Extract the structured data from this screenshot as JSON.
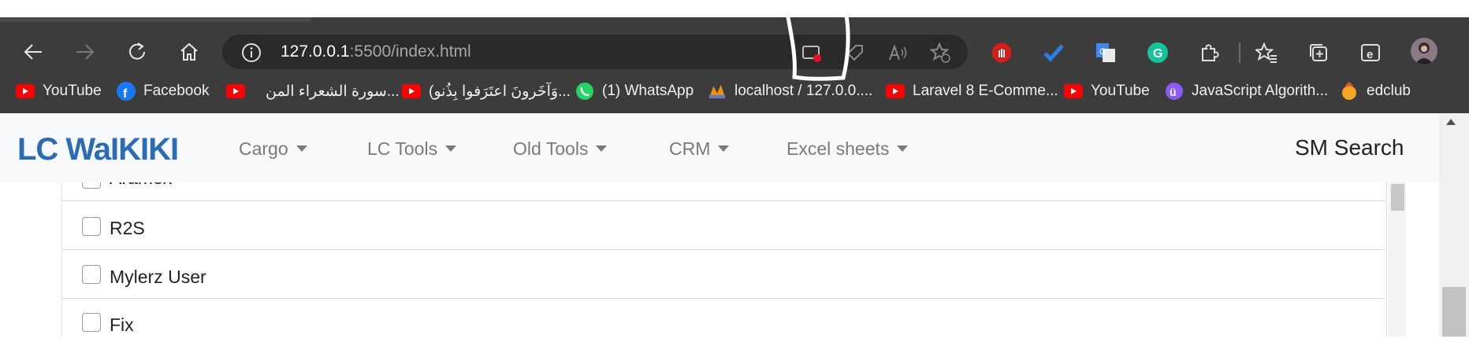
{
  "browser": {
    "url_host": "127.0.0.1",
    "url_path": ":5500/index.html",
    "bookmarks": [
      {
        "label": "YouTube",
        "icon": "youtube-icon"
      },
      {
        "label": "Facebook",
        "icon": "facebook-icon"
      },
      {
        "label": "سورة الشعراء المن...",
        "icon": "youtube-icon"
      },
      {
        "label": "(وَآخَرونَ اعتَرَفوا بِذُنو...",
        "icon": "youtube-icon"
      },
      {
        "label": "(1) WhatsApp",
        "icon": "whatsapp-icon"
      },
      {
        "label": "localhost / 127.0.0....",
        "icon": "phpmyadmin-icon"
      },
      {
        "label": "Laravel 8 E-Comme...",
        "icon": "youtube-icon"
      },
      {
        "label": "YouTube",
        "icon": "youtube-icon"
      },
      {
        "label": "JavaScript Algorith...",
        "icon": "freecodecamp-icon"
      },
      {
        "label": "edclub",
        "icon": "edclub-icon"
      }
    ]
  },
  "navbar": {
    "brand": "LC WaIKIKI",
    "menus": [
      "Cargo",
      "LC Tools",
      "Old Tools",
      "CRM",
      "Excel sheets"
    ],
    "search_label": "SM Search"
  },
  "list": {
    "items": [
      "Aramex",
      "R2S",
      "Mylerz User",
      "Fix"
    ]
  },
  "colors": {
    "brand": "#2a6db6",
    "chrome_bg": "#3c3c3c",
    "navbar_bg": "#f8f9fa"
  }
}
